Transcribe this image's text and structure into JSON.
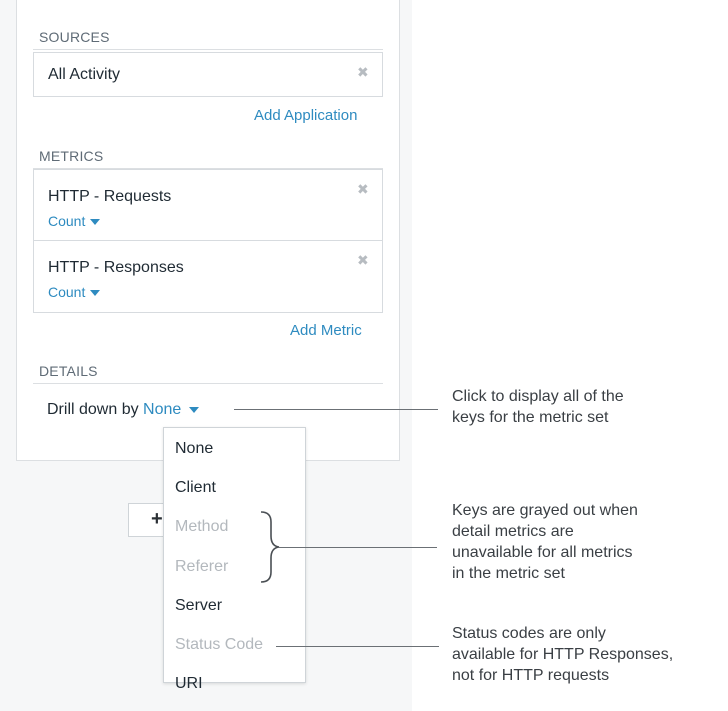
{
  "sources": {
    "label": "SOURCES",
    "items": [
      {
        "title": "All Activity"
      }
    ],
    "add_label": "Add Application"
  },
  "metrics": {
    "label": "METRICS",
    "items": [
      {
        "title": "HTTP - Requests",
        "aggregation": "Count"
      },
      {
        "title": "HTTP - Responses",
        "aggregation": "Count"
      }
    ],
    "add_label": "Add Metric"
  },
  "details": {
    "label": "DETAILS",
    "drill_prefix": "Drill down by",
    "drill_value": "None"
  },
  "dropdown": {
    "options": [
      {
        "label": "None",
        "enabled": true
      },
      {
        "label": "Client",
        "enabled": true
      },
      {
        "label": "Method",
        "enabled": false
      },
      {
        "label": "Referer",
        "enabled": false
      },
      {
        "label": "Server",
        "enabled": true
      },
      {
        "label": "Status Code",
        "enabled": false
      },
      {
        "label": "URI",
        "enabled": true
      }
    ]
  },
  "behind_button_glyph": "+",
  "annotations": [
    {
      "lines": [
        "Click to display all of the",
        "keys for the metric set"
      ]
    },
    {
      "lines": [
        "Keys are grayed out when",
        "detail metrics are",
        "unavailable for all metrics",
        "in the metric set"
      ]
    },
    {
      "lines": [
        "Status codes are only",
        "available for HTTP Responses,",
        "not for HTTP requests"
      ]
    }
  ],
  "icons": {
    "remove": "close-icon",
    "dropdown": "caret-down-icon"
  },
  "colors": {
    "link": "#2e8bc0",
    "disabled": "#b3b8bd",
    "panel_bg": "#f6f7f8"
  }
}
